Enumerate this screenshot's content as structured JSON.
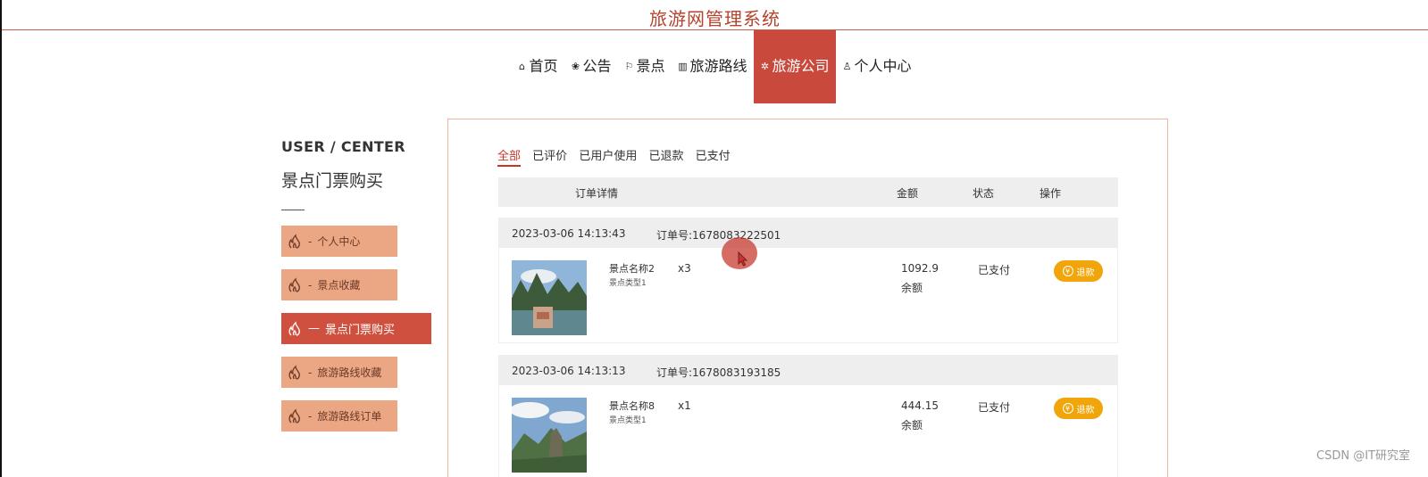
{
  "header": {
    "title": "旅游网管理系统"
  },
  "nav": [
    {
      "icon": "home-icon",
      "glyph": "⌂",
      "label": "首页"
    },
    {
      "icon": "notice-icon",
      "glyph": "❀",
      "label": "公告"
    },
    {
      "icon": "flag-icon",
      "glyph": "⚐",
      "label": "景点"
    },
    {
      "icon": "route-icon",
      "glyph": "▥",
      "label": "旅游路线"
    },
    {
      "icon": "company-icon",
      "glyph": "✲",
      "label": "旅游公司",
      "active": true
    },
    {
      "icon": "user-icon",
      "glyph": "♙",
      "label": "个人中心"
    }
  ],
  "sidebar": {
    "title_en": "USER / CENTER",
    "title_cn": "景点门票购买",
    "items": [
      {
        "label": "个人中心",
        "active": false
      },
      {
        "label": "景点收藏",
        "active": false
      },
      {
        "label": "景点门票购买",
        "active": true
      },
      {
        "label": "旅游路线收藏",
        "active": false
      },
      {
        "label": "旅游路线订单",
        "active": false
      }
    ]
  },
  "tabs": [
    {
      "label": "全部",
      "active": true
    },
    {
      "label": "已评价"
    },
    {
      "label": "已用户使用"
    },
    {
      "label": "已退款"
    },
    {
      "label": "已支付"
    }
  ],
  "table_header": {
    "detail": "订单详情",
    "amount": "金额",
    "status": "状态",
    "action": "操作"
  },
  "orders": [
    {
      "date": "2023-03-06 14:13:43",
      "order_no": "订单号:1678083222501",
      "name": "景点名称2",
      "type": "景点类型1",
      "qty": "x3",
      "amount": "1092.9",
      "pay_method": "余额",
      "status": "已支付",
      "action": "退款"
    },
    {
      "date": "2023-03-06 14:13:13",
      "order_no": "订单号:1678083193185",
      "name": "景点名称8",
      "type": "景点类型1",
      "qty": "x1",
      "amount": "444.15",
      "pay_method": "余额",
      "status": "已支付",
      "action": "退款"
    }
  ],
  "watermark": "CSDN @IT研究室",
  "colors": {
    "brand": "#c94a3d",
    "side_item": "#eba684",
    "refund": "#f0a60a"
  }
}
